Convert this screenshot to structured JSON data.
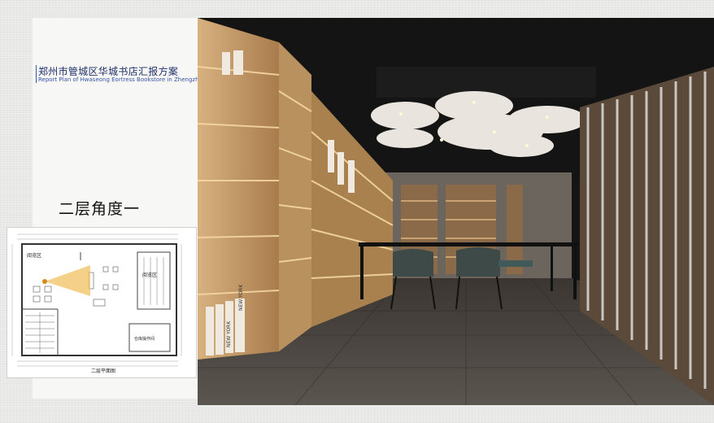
{
  "header": {
    "title_cn": "郑州市管城区华城书店汇报方案",
    "title_en": "Report Plan of Hwaseong Eortress Bookstore in Zhengzhou district"
  },
  "view": {
    "label": "二层角度一"
  },
  "floor_plan": {
    "caption": "二层平面图",
    "zones": {
      "reading_left": "阅览区",
      "reading_right": "阅览区",
      "storage": "仓库操作间"
    }
  },
  "render": {
    "book_titles": [
      "NEW YORK",
      "NEW YORK",
      "NEW YORK"
    ]
  },
  "colors": {
    "title_blue": "#1e2f66",
    "subtitle_blue": "#3553a4",
    "wood": "#c49a6c",
    "camera_cone": "#f0c060"
  }
}
